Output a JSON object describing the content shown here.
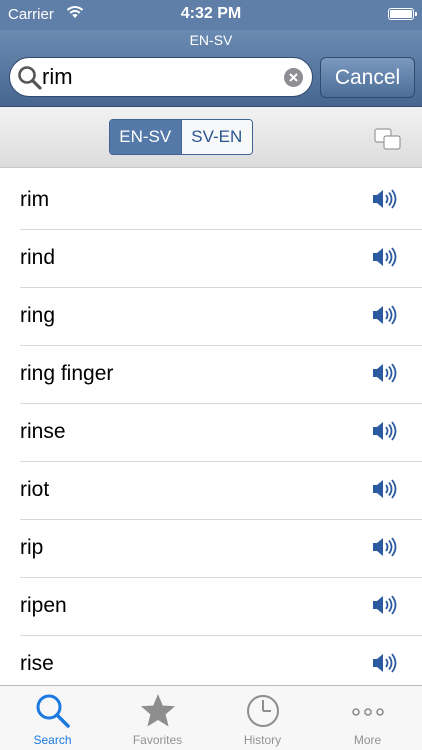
{
  "status_bar": {
    "carrier": "Carrier",
    "time": "4:32 PM"
  },
  "header": {
    "title": "EN-SV"
  },
  "search": {
    "value": "rim",
    "cancel_label": "Cancel"
  },
  "segment": {
    "options": [
      "EN-SV",
      "SV-EN"
    ],
    "selected": "EN-SV"
  },
  "words": [
    "rim",
    "rind",
    "ring",
    "ring finger",
    "rinse",
    "riot",
    "rip",
    "ripen",
    "rise"
  ],
  "tabs": [
    {
      "label": "Search",
      "icon": "search-icon",
      "active": true
    },
    {
      "label": "Favorites",
      "icon": "star-icon",
      "active": false
    },
    {
      "label": "History",
      "icon": "clock-icon",
      "active": false
    },
    {
      "label": "More",
      "icon": "more-dots-icon",
      "active": false
    }
  ],
  "colors": {
    "nav": "#5f7fa8",
    "accent": "#1a7ae0",
    "speaker": "#2c5aa0"
  }
}
